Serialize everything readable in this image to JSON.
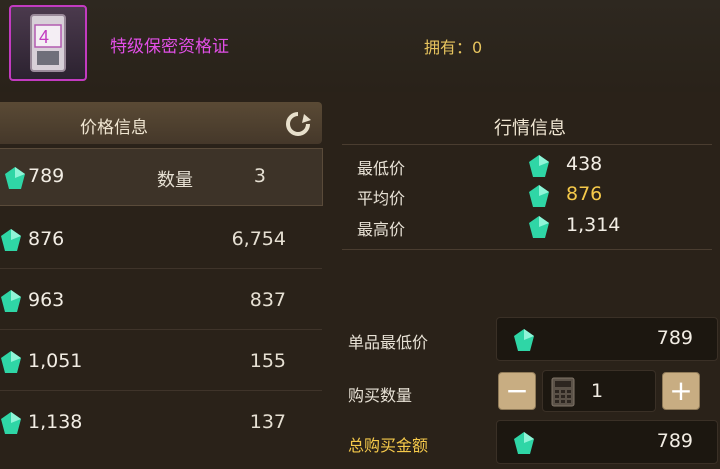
{
  "item": {
    "name": "特级保密资格证",
    "owned_label": "拥有：",
    "owned_value": "0",
    "icon": "id-card-icon",
    "icon_number": "4"
  },
  "price_panel": {
    "title": "价格信息",
    "refresh_icon": "refresh-icon",
    "rows": [
      {
        "price": "789",
        "qty_label": "数量",
        "qty": "3",
        "selected": true
      },
      {
        "price": "876",
        "qty": "6,754"
      },
      {
        "price": "963",
        "qty": "837"
      },
      {
        "price": "1,051",
        "qty": "155"
      },
      {
        "price": "1,138",
        "qty": "137"
      }
    ]
  },
  "market_panel": {
    "title": "行情信息",
    "stats": [
      {
        "label": "最低价",
        "value": "438"
      },
      {
        "label": "平均价",
        "value": "876"
      },
      {
        "label": "最高价",
        "value": "1,314"
      }
    ]
  },
  "purchase": {
    "unit_price_label": "单品最低价",
    "unit_price": "789",
    "quantity_label": "购买数量",
    "quantity": "1",
    "minus_glyph": "−",
    "plus_glyph": "+",
    "total_label": "总购买金额",
    "total": "789"
  },
  "colors": {
    "gem": "#2fd6a6",
    "accent_gold": "#f5c94a",
    "item_name": "#e14fe6"
  }
}
